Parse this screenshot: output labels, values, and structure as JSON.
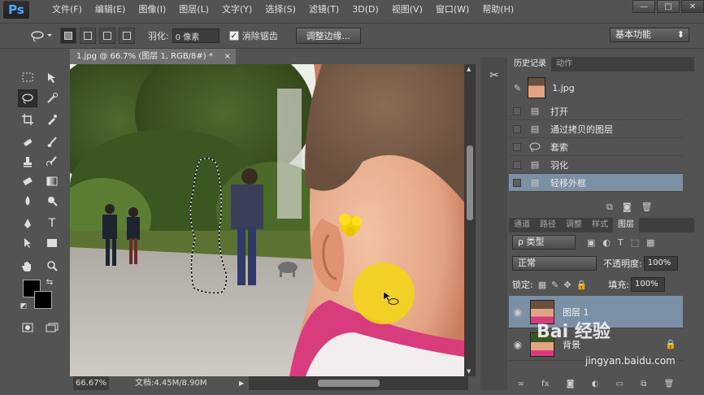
{
  "app": {
    "logo": "Ps"
  },
  "menu": [
    "文件(F)",
    "编辑(E)",
    "图像(I)",
    "图层(L)",
    "文字(Y)",
    "选择(S)",
    "滤镜(T)",
    "3D(D)",
    "视图(V)",
    "窗口(W)",
    "帮助(H)"
  ],
  "window_controls": {
    "minimize": "—",
    "maximize": "□",
    "close": "✕"
  },
  "options": {
    "feather_label": "羽化:",
    "feather_value": "0 像素",
    "antialias_label": "消除锯齿",
    "antialias_checked": "✓",
    "refine_edge_button": "调整边缘...",
    "workspace": "基本功能"
  },
  "document": {
    "tab_title": "1.jpg @ 66.7% (图层 1, RGB/8#) *",
    "tab_close": "×",
    "zoom": "66.67%",
    "doc_info": "文档:4.45M/8.90M"
  },
  "history": {
    "tabs": [
      "历史记录",
      "动作"
    ],
    "snapshot_label": "1.jpg",
    "items": [
      "打开",
      "通过拷贝的图层",
      "套索",
      "羽化",
      "轻移外框"
    ]
  },
  "layers": {
    "tabs": [
      "通道",
      "路径",
      "调整",
      "样式",
      "图层"
    ],
    "filter_label": "ρ 类型",
    "blend_mode": "正常",
    "opacity_label": "不透明度:",
    "opacity_value": "100%",
    "lock_label": "锁定:",
    "fill_label": "填充:",
    "fill_value": "100%",
    "items": [
      {
        "name": "图层 1"
      },
      {
        "name": "背景"
      }
    ]
  },
  "watermark": {
    "brand": "Bai 经验",
    "url": "jingyan.baidu.com"
  },
  "colors": {
    "accent": "#7b8fa5",
    "selection": "#f2d21c"
  }
}
